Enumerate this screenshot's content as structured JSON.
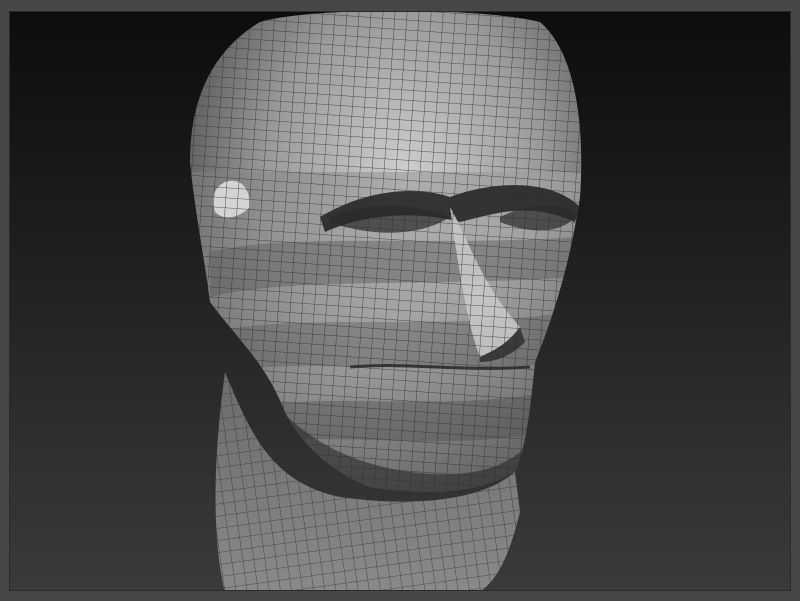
{
  "app": {
    "scene": "sculpted-head-mesh",
    "colors": {
      "background_top": "#0d0d0d",
      "background_bottom": "#3a3a3a",
      "frame": "#474747",
      "mesh_base": "#8c8c8c",
      "mesh_highlight": "#d0d0d0",
      "mesh_shadow": "#3a3a3a",
      "wire": "#2e2e2e"
    },
    "icons": {
      "model": "head-mesh-icon"
    }
  }
}
